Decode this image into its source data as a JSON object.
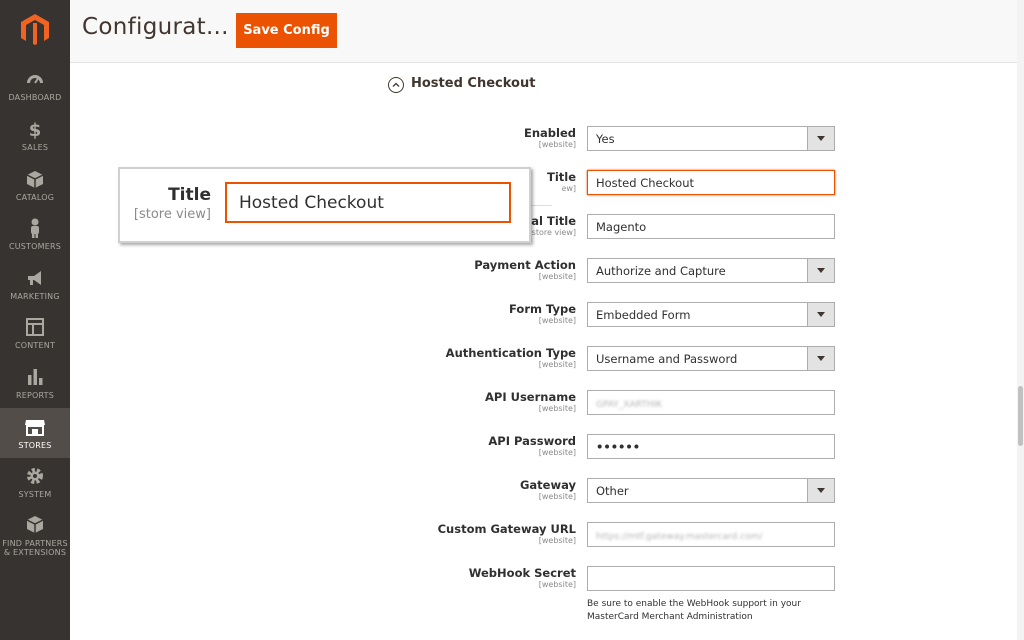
{
  "sidebar": {
    "logo": "magento-logo-icon",
    "items": [
      {
        "label": "DASHBOARD",
        "icon": "dashboard-icon"
      },
      {
        "label": "SALES",
        "icon": "dollar-icon"
      },
      {
        "label": "CATALOG",
        "icon": "box-icon"
      },
      {
        "label": "CUSTOMERS",
        "icon": "person-icon"
      },
      {
        "label": "MARKETING",
        "icon": "megaphone-icon"
      },
      {
        "label": "CONTENT",
        "icon": "layout-icon"
      },
      {
        "label": "REPORTS",
        "icon": "bar-chart-icon"
      },
      {
        "label": "STORES",
        "icon": "store-icon",
        "active": true
      },
      {
        "label": "SYSTEM",
        "icon": "gear-icon"
      },
      {
        "label": "FIND PARTNERS",
        "label2": "& EXTENSIONS",
        "icon": "cube-icon"
      }
    ]
  },
  "header": {
    "title": "Configurat...",
    "save_label": "Save Config"
  },
  "section": {
    "title": "Hosted Checkout"
  },
  "fields": [
    {
      "label": "Enabled",
      "scope": "[website]",
      "value": "Yes",
      "type": "select"
    },
    {
      "label": "Title",
      "scope": "[store view]",
      "value": "Hosted Checkout",
      "type": "text"
    },
    {
      "label": "Modal Title",
      "scope": "[store view]",
      "value": "Magento",
      "type": "text"
    },
    {
      "label": "Payment Action",
      "scope": "[website]",
      "value": "Authorize and Capture",
      "type": "select"
    },
    {
      "label": "Form Type",
      "scope": "[website]",
      "value": "Embedded Form",
      "type": "select"
    },
    {
      "label": "Authentication Type",
      "scope": "[website]",
      "value": "Username and Password",
      "type": "select"
    },
    {
      "label": "API Username",
      "scope": "[website]",
      "value": "GPAY_XARTHIK",
      "type": "text"
    },
    {
      "label": "API Password",
      "scope": "[website]",
      "value": "••••••",
      "type": "password"
    },
    {
      "label": "Gateway",
      "scope": "[website]",
      "value": "Other",
      "type": "select"
    },
    {
      "label": "Custom Gateway URL",
      "scope": "[website]",
      "value": "https://mtf.gateway.mastercard.com/",
      "type": "text"
    },
    {
      "label": "WebHook Secret",
      "scope": "[website]",
      "value": "",
      "type": "text"
    }
  ],
  "webhook_note": "Be sure to enable the WebHook support in your MasterCard Merchant Administration",
  "zoom_callout": {
    "label": "Title",
    "scope": "[store view]",
    "value": "Hosted Checkout"
  },
  "colors": {
    "accent": "#eb5202",
    "sidebar": "#373330",
    "sidebar_active": "#524d49"
  }
}
